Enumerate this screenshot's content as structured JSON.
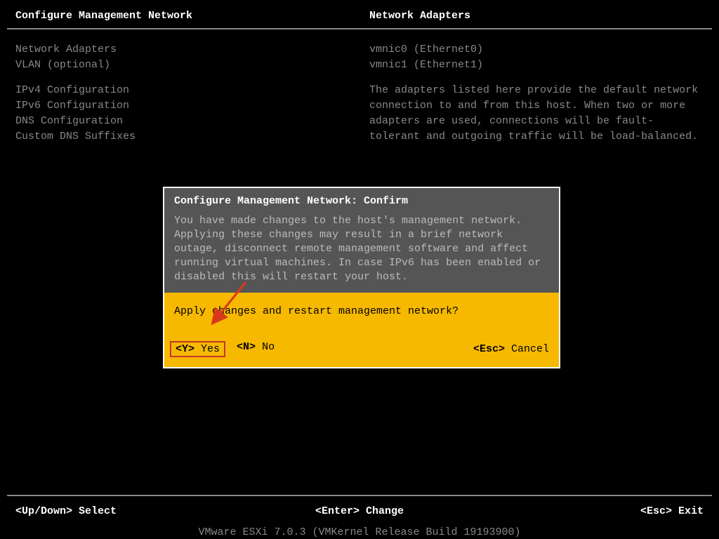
{
  "header": {
    "left": "Configure Management Network",
    "right": "Network Adapters"
  },
  "menu": {
    "items_top": [
      "Network Adapters",
      "VLAN (optional)"
    ],
    "items_bottom": [
      "IPv4 Configuration",
      "IPv6 Configuration",
      "DNS Configuration",
      "Custom DNS Suffixes"
    ]
  },
  "right_panel": {
    "adapters": [
      "vmnic0 (Ethernet0)",
      "vmnic1 (Ethernet1)"
    ],
    "description": "The adapters listed here provide the default network connection to and from this host. When two or more adapters are used, connections will be fault-tolerant and outgoing traffic will be load-balanced."
  },
  "dialog": {
    "title": "Configure Management Network: Confirm",
    "body": "You have made changes to the host's management network. Applying these changes may result in a brief network outage, disconnect remote management software and affect running virtual machines.  In case IPv6 has been enabled or disabled this will restart your host.",
    "question": "Apply changes and restart management network?",
    "yes_key": "<Y>",
    "yes_label": "Yes",
    "no_key": "<N>",
    "no_label": "No",
    "cancel_key": "<Esc>",
    "cancel_label": "Cancel"
  },
  "footer": {
    "select_key": "<Up/Down>",
    "select_label": "Select",
    "change_key": "<Enter>",
    "change_label": "Change",
    "exit_key": "<Esc>",
    "exit_label": "Exit"
  },
  "product_line": "VMware ESXi 7.0.3 (VMKernel Release Build 19193900)"
}
